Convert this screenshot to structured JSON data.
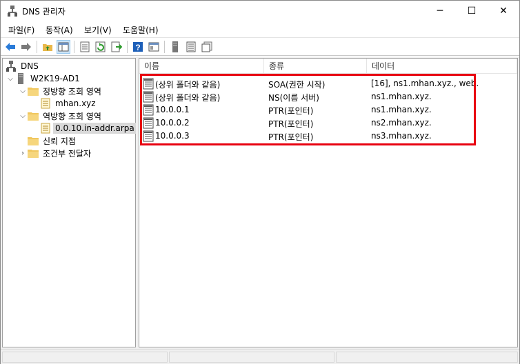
{
  "window": {
    "title": "DNS 관리자"
  },
  "title_buttons": {
    "minimize": "─",
    "maximize": "☐",
    "close": "✕"
  },
  "menu": [
    "파일(F)",
    "동작(A)",
    "보기(V)",
    "도움말(H)"
  ],
  "toolbar": {
    "buttons": [
      "back-icon",
      "forward-icon",
      "up-folder-icon",
      "show-tree-icon",
      "properties-icon",
      "refresh-icon",
      "export-icon",
      "help-icon",
      "console-icon",
      "server-icon",
      "record-list-icon",
      "copy-icon"
    ]
  },
  "tree": {
    "root": "DNS",
    "server": "W2K19-AD1",
    "forward_zone": "정방향 조회 영역",
    "forward_zone_child": "mhan.xyz",
    "reverse_zone": "역방향 조회 영역",
    "reverse_zone_child": "0.0.10.in-addr.arpa",
    "trust_points": "신뢰 지점",
    "conditional_forwarders": "조건부 전달자"
  },
  "list": {
    "columns": [
      "이름",
      "종류",
      "데이터"
    ],
    "rows": [
      {
        "name": "(상위 폴더와 같음)",
        "type": "SOA(권한 시작)",
        "data": "[16], ns1.mhan.xyz., web."
      },
      {
        "name": "(상위 폴더와 같음)",
        "type": "NS(이름 서버)",
        "data": "ns1.mhan.xyz."
      },
      {
        "name": "10.0.0.1",
        "type": "PTR(포인터)",
        "data": "ns1.mhan.xyz."
      },
      {
        "name": "10.0.0.2",
        "type": "PTR(포인터)",
        "data": "ns2.mhan.xyz."
      },
      {
        "name": "10.0.0.3",
        "type": "PTR(포인터)",
        "data": "ns3.mhan.xyz."
      }
    ]
  },
  "colors": {
    "highlight": "#e8000f",
    "selection": "#d9d9d9",
    "folder": "#f0c75e"
  }
}
